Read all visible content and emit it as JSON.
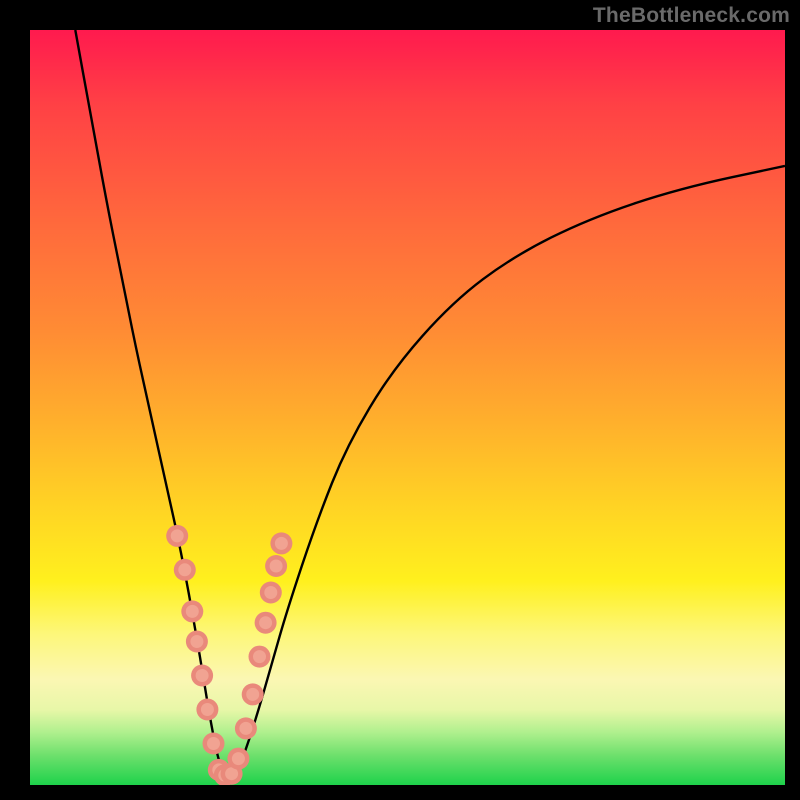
{
  "attribution": "TheBottleneck.com",
  "colors": {
    "bg_black": "#000000",
    "red": "#ff1a4e",
    "orange": "#ff8c34",
    "yellow": "#fff01e",
    "green": "#1ed24b",
    "marker_ring": "#e9897b",
    "marker_core": "#f1a392",
    "text": "#6a6a6a"
  },
  "chart_data": {
    "type": "line",
    "title": "",
    "xlabel": "",
    "ylabel": "",
    "xlim": [
      0,
      100
    ],
    "ylim": [
      0,
      100
    ],
    "grid": false,
    "legend": false,
    "annotations": [
      "TheBottleneck.com"
    ],
    "series": [
      {
        "name": "bottleneck-curve",
        "x": [
          6,
          8,
          10,
          12,
          14,
          16,
          18,
          20,
          22,
          23,
          24,
          25,
          26,
          27,
          28,
          30,
          32,
          34,
          38,
          42,
          48,
          56,
          64,
          74,
          86,
          100
        ],
        "y": [
          100,
          89,
          78,
          68,
          58,
          49,
          40,
          31,
          20,
          14,
          8,
          3,
          1,
          1,
          3,
          9,
          16,
          23,
          35,
          45,
          55,
          64,
          70,
          75,
          79,
          82
        ]
      }
    ],
    "markers": {
      "name": "highlighted-points",
      "x": [
        19.5,
        20.5,
        21.5,
        22.1,
        22.8,
        23.5,
        24.3,
        25.0,
        25.8,
        26.7,
        27.6,
        28.6,
        29.5,
        30.4,
        31.2,
        31.9,
        32.6,
        33.3
      ],
      "y": [
        33.0,
        28.5,
        23.0,
        19.0,
        14.5,
        10.0,
        5.5,
        2.0,
        1.3,
        1.5,
        3.5,
        7.5,
        12.0,
        17.0,
        21.5,
        25.5,
        29.0,
        32.0
      ]
    }
  }
}
